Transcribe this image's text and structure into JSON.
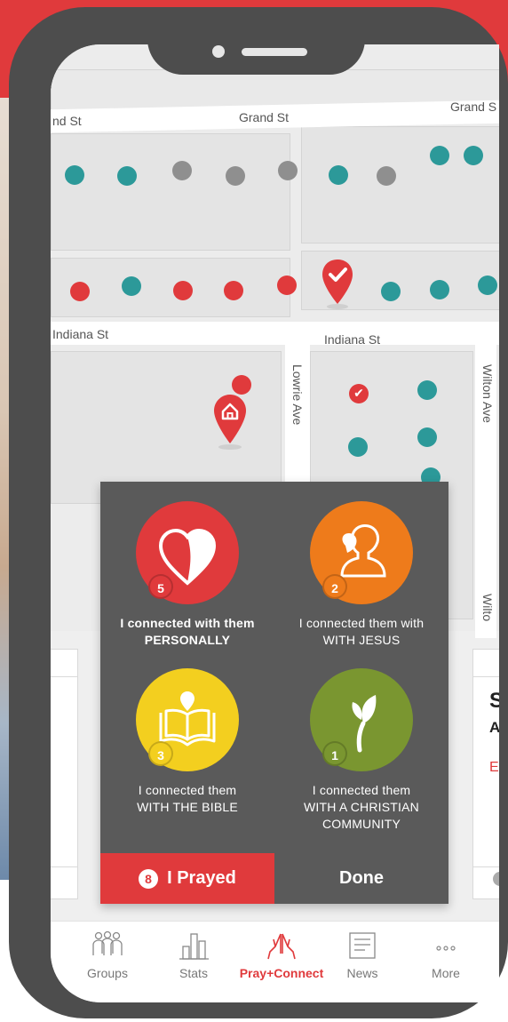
{
  "map": {
    "streets": {
      "grand_st_left": "nd St",
      "grand_st_center": "Grand St",
      "grand_st_right": "Grand S",
      "indiana_st_left": "Indiana St",
      "indiana_st_right": "Indiana St",
      "lowrie_ave": "Lowrie Ave",
      "wilton_ave": "Wilton Ave",
      "wilto": "Wilto"
    },
    "colors": {
      "teal": "#2c9999",
      "red": "#e03a3c",
      "gray": "#8f8f8f"
    }
  },
  "connect_panel": {
    "options": [
      {
        "count": "5",
        "line1": "I connected with them",
        "line2": "PERSONALLY",
        "line3": "",
        "color": "#e03a3c",
        "icon": "heart-icon"
      },
      {
        "count": "2",
        "line1": "I connected them with",
        "line2": "WITH JESUS",
        "line3": "",
        "color": "#ee7b1b",
        "icon": "jesus-icon"
      },
      {
        "count": "3",
        "line1": "I connected them",
        "line2": "WITH THE BIBLE",
        "line3": "",
        "color": "#f3cf1f",
        "icon": "bible-icon"
      },
      {
        "count": "1",
        "line1": "I connected them",
        "line2": "WITH A CHRISTIAN",
        "line3": "COMMUNITY",
        "color": "#7a9630",
        "icon": "plant-icon"
      }
    ],
    "prayed_count": "8",
    "prayed_label": "I Prayed",
    "done_label": "Done"
  },
  "side_card": {
    "title_partial": "S",
    "subtitle_partial": "A",
    "link_partial": "Ec"
  },
  "tabbar": {
    "tabs": [
      {
        "label": "Groups",
        "icon": "groups-icon"
      },
      {
        "label": "Stats",
        "icon": "stats-icon"
      },
      {
        "label": "Pray+Connect",
        "icon": "praying-hands-icon",
        "active": true
      },
      {
        "label": "News",
        "icon": "news-icon"
      },
      {
        "label": "More",
        "icon": "more-icon"
      }
    ]
  }
}
